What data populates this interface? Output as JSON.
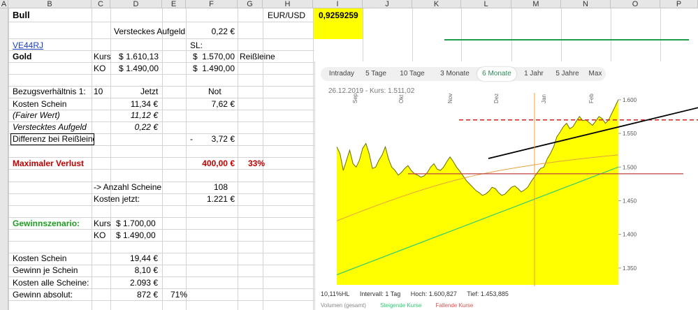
{
  "columns": [
    "A",
    "B",
    "C",
    "D",
    "E",
    "F",
    "G",
    "H",
    "I",
    "J",
    "K",
    "L",
    "M",
    "N",
    "O",
    "P"
  ],
  "cells": {
    "title": "Bull",
    "rate_label": "EUR/USD",
    "rate_value": "0,9259259",
    "verstecktes_label": "Versteckes Aufgeld",
    "verstecktes_value": "0,22 €",
    "wkn": "VE44RJ",
    "sl_label": "SL:",
    "gold": "Gold",
    "kurs1": "Kurs",
    "kurs_dollar": "$",
    "kurs_value": "1.610,13",
    "ko1": "KO",
    "ko_value": "1.490,00",
    "sl_value": "1.570,00",
    "reissleine": "Reißleine",
    "ko_not_value": "1.490,00",
    "bezug_label": "Bezugsverhältnis 1:",
    "bezug_value": "10",
    "jetzt": "Jetzt",
    "not": "Not",
    "kosten_label": "Kosten Schein",
    "kosten_jetzt": "11,34 €",
    "kosten_not": "7,62 €",
    "fairer_label": "(Fairer Wert)",
    "fairer_value": "11,12 €",
    "versteckt2_label": "Verstecktes Aufgeld",
    "versteckt2_value": "0,22 €",
    "differenz_label": "Differenz bei Reißleine",
    "differenz_sign": "-",
    "differenz_value": "3,72 €",
    "maxverlust_label": "Maximaler Verlust",
    "maxverlust_value": "400,00 €",
    "maxverlust_pct": "33%",
    "anzahl_label": "-> Anzahl Scheine",
    "anzahl_value": "108",
    "kostenjetzt_label": "Kosten jetzt:",
    "kostenjetzt_value": "1.221 €",
    "gewinn_label": "Gewinnszenario:",
    "gkurs": "Kurs",
    "gkurs_value": "$ 1.700,00",
    "gko": "KO",
    "gko_value": "$ 1.490,00",
    "gkosten_label": "Kosten Schein",
    "gkosten_value": "19,44 €",
    "gjeschein_label": "Gewinn je Schein",
    "gjeschein_value": "8,10 €",
    "galle_label": "Kosten alle Scheine:",
    "galle_value": "2.093 €",
    "gabs_label": "Gewinn absolut:",
    "gabs_value": "872 €",
    "gabs_pct": "71%"
  },
  "chart": {
    "tabs": [
      "Intraday",
      "5 Tage",
      "10 Tage",
      "3 Monate",
      "6 Monate",
      "1 Jahr",
      "5 Jahre",
      "Max"
    ],
    "active_tab": "6 Monate",
    "info_date": "26.12.2019",
    "info_sep": "-",
    "info_kurs": "Kurs: 1.511,02",
    "months": [
      "Sep",
      "Okt",
      "Nov",
      "Dez",
      "Jan",
      "Feb"
    ],
    "y_ticks": [
      "1.600",
      "1.550",
      "1.500",
      "1.450",
      "1.400",
      "1.350"
    ],
    "footer": [
      "10,11%HL",
      "Intervall: 1 Tag",
      "Hoch: 1.600,827",
      "Tief: 1.453,885"
    ],
    "legend": [
      "Volumen (gesamt)",
      "Steigende Kurse",
      "Fallende Kurse"
    ],
    "colors": {
      "area": "#ffff00",
      "price_line": "#6b6b00",
      "ma_long": "#2ecc71",
      "ma_mid": "#e8a040",
      "resistance": "#d62020",
      "trend": "#000000",
      "ma_orange": "#f0a030"
    }
  },
  "chart_data": {
    "type": "area",
    "title": "",
    "xlabel": "",
    "ylabel": "",
    "ylim": [
      1325,
      1605
    ],
    "x_labels": [
      "Sep",
      "Okt",
      "Nov",
      "Dez",
      "Jan",
      "Feb"
    ],
    "series": [
      {
        "values": [
          1530,
          1520,
          1495,
          1510,
          1525,
          1505,
          1500,
          1510,
          1528,
          1535,
          1520,
          1498,
          1500,
          1510,
          1518,
          1530,
          1512,
          1500,
          1495,
          1488,
          1492,
          1498,
          1502,
          1495,
          1490,
          1488,
          1485,
          1487,
          1492,
          1500,
          1505,
          1497,
          1495,
          1500,
          1508,
          1515,
          1508,
          1500,
          1494,
          1487,
          1480,
          1475,
          1470,
          1465,
          1462,
          1458,
          1460,
          1464,
          1470,
          1468,
          1462,
          1458,
          1460,
          1465,
          1470,
          1472,
          1468,
          1463,
          1466,
          1470,
          1478,
          1485,
          1492,
          1498,
          1500,
          1512,
          1520,
          1530,
          1545,
          1552,
          1560,
          1565,
          1557,
          1560,
          1568,
          1575,
          1569,
          1570,
          1566,
          1562,
          1568,
          1575,
          1572,
          1565,
          1570,
          1580,
          1590,
          1600
        ]
      }
    ]
  }
}
